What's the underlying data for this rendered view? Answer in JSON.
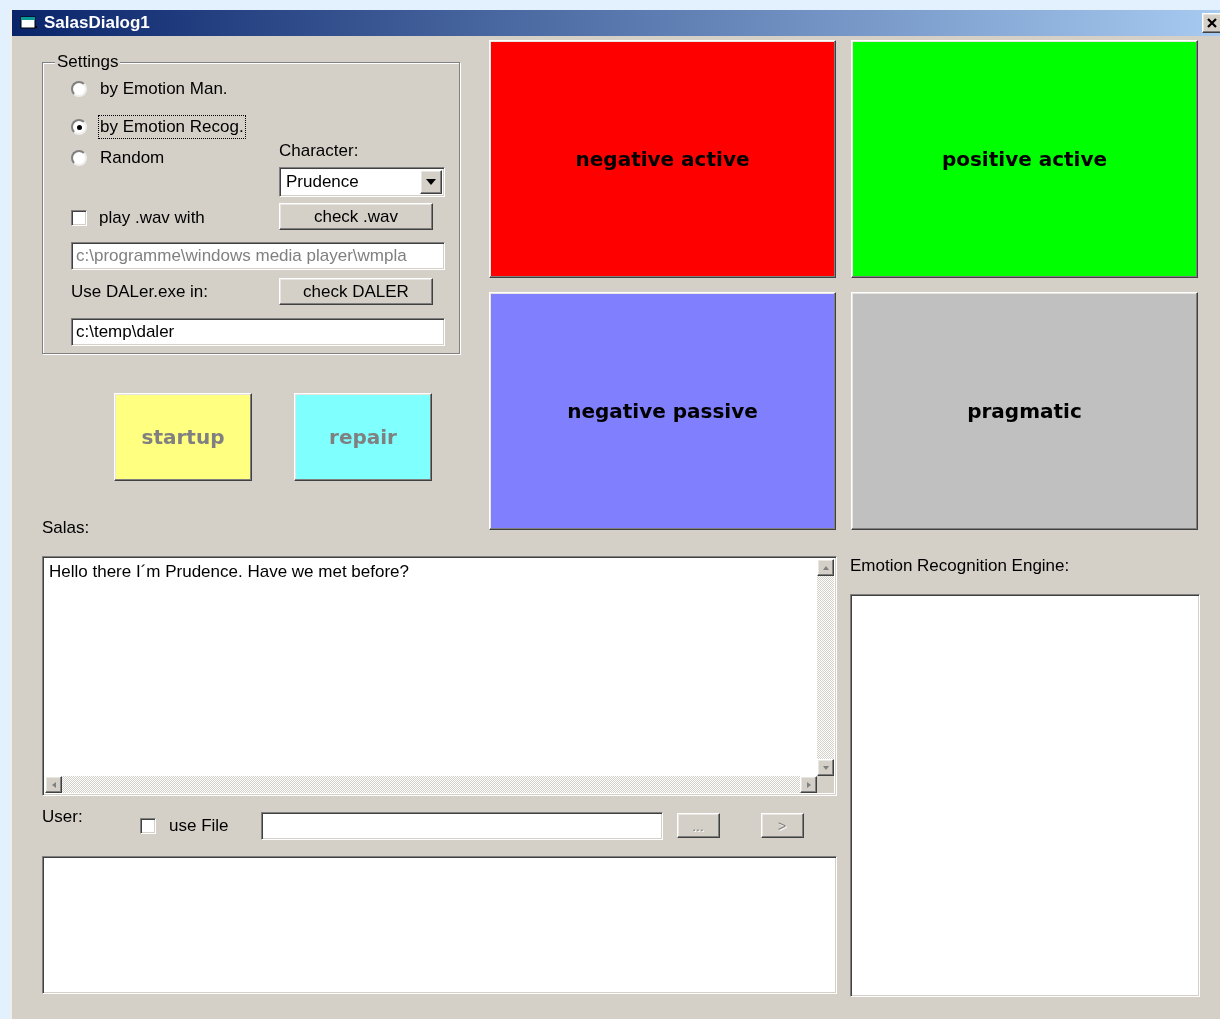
{
  "window": {
    "title": "SalasDialog1"
  },
  "settings": {
    "title": "Settings",
    "modes": [
      {
        "label": "by Emotion Man.",
        "selected": false,
        "focused": false
      },
      {
        "label": "by Emotion Recog.",
        "selected": true,
        "focused": true
      },
      {
        "label": "Random",
        "selected": false,
        "focused": false
      }
    ],
    "character": {
      "label": "Character:",
      "value": "Prudence"
    },
    "play_wav": {
      "label": "play .wav with",
      "checked": false
    },
    "check_wav_button": "check .wav",
    "player_path": {
      "value": "c:\\programme\\windows media player\\wmpla",
      "disabled": true
    },
    "daler": {
      "label": "Use DALer.exe in:",
      "button": "check DALER",
      "path": "c:\\temp\\daler"
    }
  },
  "actions": [
    {
      "label": "startup",
      "color": "#ffff80",
      "disabled": true
    },
    {
      "label": "repair",
      "color": "#80ffff",
      "disabled": true
    }
  ],
  "emotions": [
    {
      "label": "negative active",
      "color": "#ff0000"
    },
    {
      "label": "positive active",
      "color": "#00ff00"
    },
    {
      "label": "negative passive",
      "color": "#8080ff"
    },
    {
      "label": "pragmatic",
      "color": "#c0c0c0"
    }
  ],
  "salas": {
    "label": "Salas:",
    "text": "Hello there I´m Prudence. Have we met before?"
  },
  "user": {
    "label": "User:",
    "use_file": {
      "label": "use File",
      "checked": false
    },
    "browse_button": {
      "label": "...",
      "disabled": true
    },
    "send_button": {
      "label": ">",
      "disabled": true
    }
  },
  "engine": {
    "label": "Emotion Recognition Engine:"
  }
}
